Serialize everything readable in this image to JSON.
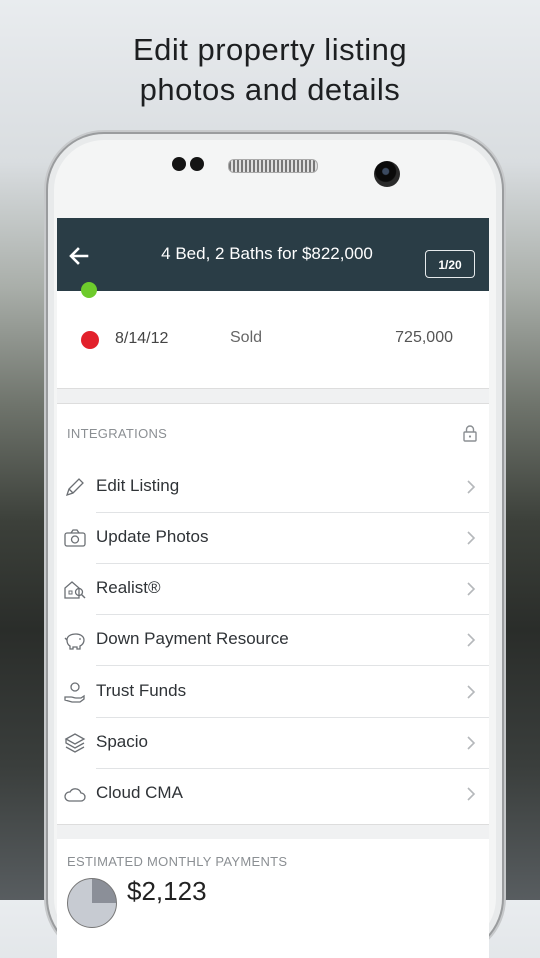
{
  "promo": {
    "line1": "Edit property listing",
    "line2": "photos and details"
  },
  "appbar": {
    "title": "4 Bed, 2 Baths for $822,000",
    "counter": "1/20",
    "back_icon": "arrow-left-icon"
  },
  "history": {
    "date": "8/14/12",
    "status": "Sold",
    "price": "725,000",
    "dot_color": "#e2202b"
  },
  "integrations": {
    "header": "INTEGRATIONS",
    "items": [
      {
        "label": "Edit Listing",
        "icon": "pencil-icon"
      },
      {
        "label": "Update Photos",
        "icon": "camera-icon"
      },
      {
        "label": "Realist®",
        "icon": "house-search-icon"
      },
      {
        "label": "Down Payment Resource",
        "icon": "piggy-bank-icon"
      },
      {
        "label": "Trust Funds",
        "icon": "hand-money-icon"
      },
      {
        "label": "Spacio",
        "icon": "spacio-logo-icon"
      },
      {
        "label": "Cloud CMA",
        "icon": "cloud-icon"
      }
    ]
  },
  "payments": {
    "header": "ESTIMATED MONTHLY PAYMENTS",
    "amount": "$2,123"
  },
  "colors": {
    "appbar": "#2a3d46",
    "sold": "#e2202b",
    "active": "#6ecb2c"
  }
}
